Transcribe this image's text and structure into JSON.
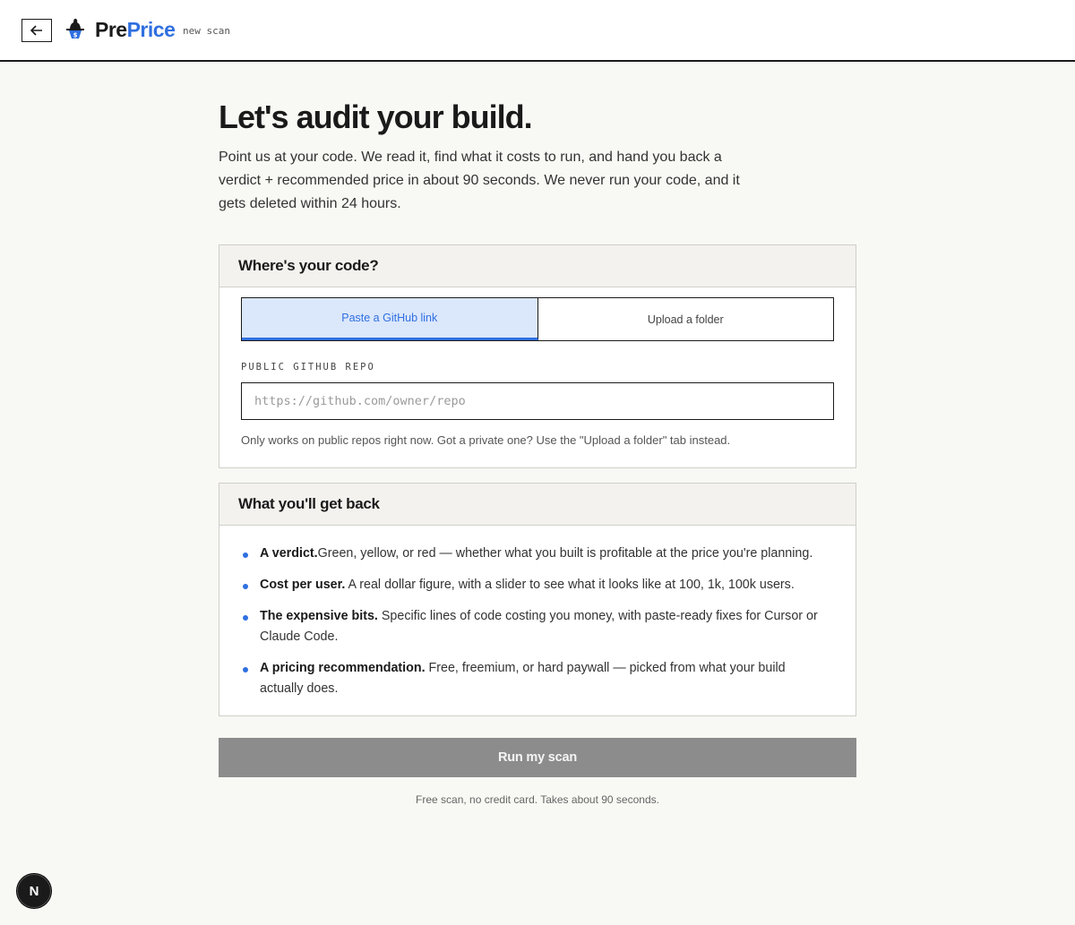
{
  "header": {
    "brand_pre": "Pre",
    "brand_price": "Price",
    "tag": "new scan",
    "accent_color": "#2f6fe0",
    "icons": [
      "arrow-left-icon",
      "logo-icon"
    ]
  },
  "hero": {
    "title": "Let's audit your build.",
    "intro": "Point us at your code. We read it, find what it costs to run, and hand you back a verdict + recommended price in about 90 seconds. We never run your code, and it gets deleted within 24 hours."
  },
  "source_card": {
    "heading": "Where's your code?",
    "tabs": [
      {
        "label": "Paste a GitHub link",
        "active": true
      },
      {
        "label": "Upload a folder",
        "active": false
      }
    ],
    "field_label": "PUBLIC GITHUB REPO",
    "input_value": "",
    "input_placeholder": "https://github.com/owner/repo",
    "help_text": "Only works on public repos right now. Got a private one? Use the \"Upload a folder\" tab instead."
  },
  "benefits_card": {
    "heading": "What you'll get back",
    "items": [
      {
        "title": "A verdict.",
        "text": "Green, yellow, or red — whether what you built is profitable at the price you're planning."
      },
      {
        "title": "Cost per user.",
        "text": " A real dollar figure, with a slider to see what it looks like at 100, 1k, 100k users."
      },
      {
        "title": "The expensive bits.",
        "text": " Specific lines of code costing you money, with paste-ready fixes for Cursor or Claude Code."
      },
      {
        "title": "A pricing recommendation.",
        "text": " Free, freemium, or hard paywall — picked from what your build actually does."
      }
    ]
  },
  "action": {
    "button_label": "Run my scan",
    "footnote": "Free scan, no credit card. Takes about 90 seconds."
  },
  "dev_badge": {
    "letter": "N"
  }
}
